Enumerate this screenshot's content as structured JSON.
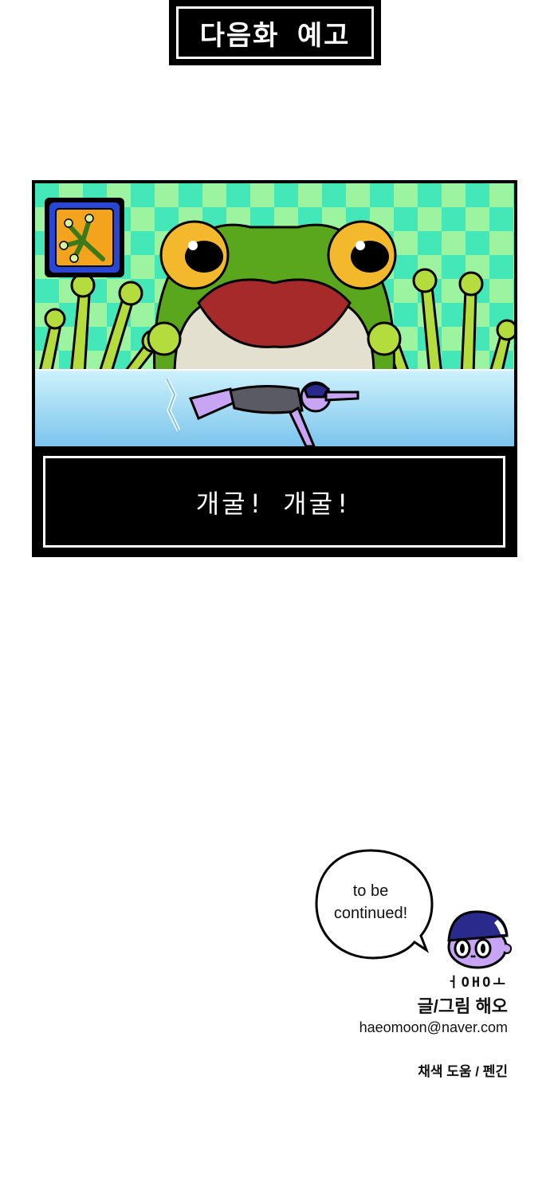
{
  "title": "다음화 예고",
  "dialog": "개굴! 개굴!",
  "bubble": {
    "line1": "to be",
    "line2": "continued!"
  },
  "credits": {
    "logo": "ㅓOHOㅗ",
    "author": "글/그림 해오",
    "email": "haeomoon@naver.com",
    "color_help": "채색 도움 / 펜긴"
  },
  "colors": {
    "frog_green": "#5aa61c",
    "checker_light": "#9cf4a0",
    "checker_dark": "#44e8b8",
    "water": "#aee4f4",
    "eye_yellow": "#f4b82c",
    "mouth_red": "#a62a2a",
    "card_blue": "#2a46d4",
    "card_orange": "#f4a41c",
    "avatar_navy": "#2a2a8c",
    "avatar_purple": "#c8a4f4"
  },
  "icons": {
    "card": "frog-hand-card-icon"
  }
}
